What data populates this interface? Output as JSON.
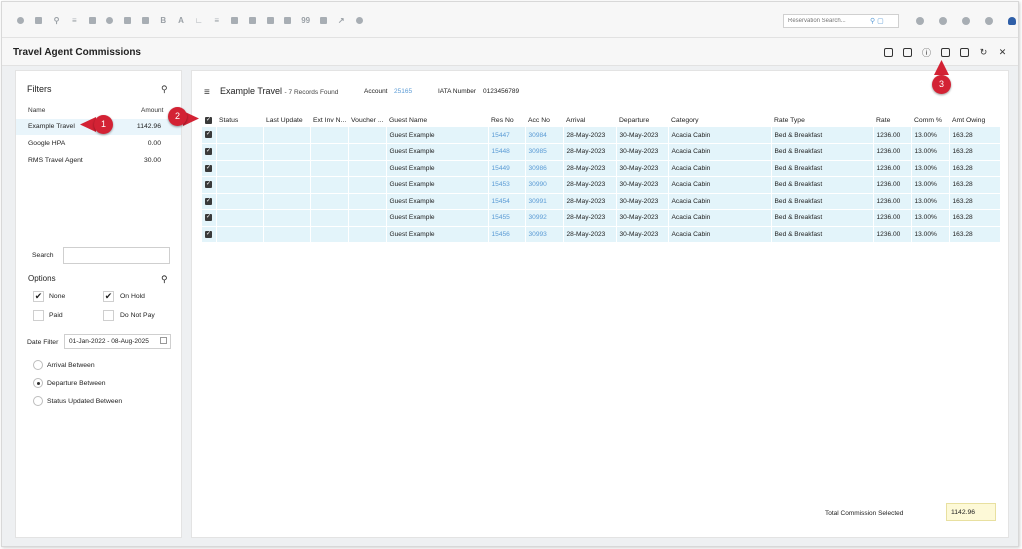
{
  "toolbar": {
    "icons": [
      "circle-icon",
      "calendar-icon",
      "search-icon",
      "sliders-icon",
      "grid-icon",
      "users-icon",
      "money-icon",
      "map-icon",
      "bold-icon",
      "font-icon",
      "chart-icon",
      "list-icon",
      "card-icon",
      "document-icon",
      "cart-icon",
      "ticket-icon",
      "quote-icon",
      "bed-icon",
      "tools-icon",
      "settings-icon"
    ],
    "letters": {
      "bold": "B",
      "font": "A",
      "quote": "99"
    },
    "search_placeholder": "Reservation Search..."
  },
  "page": {
    "title": "Travel Agent Commissions"
  },
  "filters": {
    "title": "Filters",
    "col_name": "Name",
    "col_amount": "Amount",
    "agents": [
      {
        "name": "Example Travel",
        "amount": "1142.96"
      },
      {
        "name": "Google HPA",
        "amount": "0.00"
      },
      {
        "name": "RMS Travel Agent",
        "amount": "30.00"
      }
    ],
    "search_label": "Search",
    "search_value": "",
    "options_title": "Options",
    "options": [
      {
        "label": "None",
        "checked": true
      },
      {
        "label": "On Hold",
        "checked": true
      },
      {
        "label": "Paid",
        "checked": false
      },
      {
        "label": "Do Not Pay",
        "checked": false
      }
    ],
    "date_filter_label": "Date Filter",
    "date_range": "01-Jan-2022   -   08-Aug-2025",
    "radios": [
      {
        "label": "Arrival Between",
        "selected": false
      },
      {
        "label": "Departure Between",
        "selected": true
      },
      {
        "label": "Status Updated Between",
        "selected": false
      }
    ]
  },
  "main": {
    "agent_name": "Example Travel",
    "records_found": " - 7 Records Found",
    "account_label": "Account",
    "account_value": "25165",
    "iata_label": "IATA Number",
    "iata_value": "0123456789",
    "columns": [
      "Status",
      "Last Update",
      "Ext Inv N...",
      "Voucher ...",
      "Guest Name",
      "Res No",
      "Acc No",
      "Arrival",
      "Departure",
      "Category",
      "Rate Type",
      "Rate",
      "Comm %",
      "Amt Owing"
    ],
    "rows": [
      {
        "status": "",
        "last_update": "",
        "ext_inv": "",
        "voucher": "",
        "guest": "Guest Example",
        "res_no": "15447",
        "acc_no": "30984",
        "arrival": "28-May-2023",
        "departure": "30-May-2023",
        "category": "Acacia Cabin",
        "rate_type": "Bed & Breakfast",
        "rate": "1236.00",
        "comm": "13.00%",
        "owing": "163.28"
      },
      {
        "status": "",
        "last_update": "",
        "ext_inv": "",
        "voucher": "",
        "guest": "Guest Example",
        "res_no": "15448",
        "acc_no": "30985",
        "arrival": "28-May-2023",
        "departure": "30-May-2023",
        "category": "Acacia Cabin",
        "rate_type": "Bed & Breakfast",
        "rate": "1236.00",
        "comm": "13.00%",
        "owing": "163.28"
      },
      {
        "status": "",
        "last_update": "",
        "ext_inv": "",
        "voucher": "",
        "guest": "Guest Example",
        "res_no": "15449",
        "acc_no": "30986",
        "arrival": "28-May-2023",
        "departure": "30-May-2023",
        "category": "Acacia Cabin",
        "rate_type": "Bed & Breakfast",
        "rate": "1236.00",
        "comm": "13.00%",
        "owing": "163.28"
      },
      {
        "status": "",
        "last_update": "",
        "ext_inv": "",
        "voucher": "",
        "guest": "Guest Example",
        "res_no": "15453",
        "acc_no": "30990",
        "arrival": "28-May-2023",
        "departure": "30-May-2023",
        "category": "Acacia Cabin",
        "rate_type": "Bed & Breakfast",
        "rate": "1236.00",
        "comm": "13.00%",
        "owing": "163.28"
      },
      {
        "status": "",
        "last_update": "",
        "ext_inv": "",
        "voucher": "",
        "guest": "Guest Example",
        "res_no": "15454",
        "acc_no": "30991",
        "arrival": "28-May-2023",
        "departure": "30-May-2023",
        "category": "Acacia Cabin",
        "rate_type": "Bed & Breakfast",
        "rate": "1236.00",
        "comm": "13.00%",
        "owing": "163.28"
      },
      {
        "status": "",
        "last_update": "",
        "ext_inv": "",
        "voucher": "",
        "guest": "Guest Example",
        "res_no": "15455",
        "acc_no": "30992",
        "arrival": "28-May-2023",
        "departure": "30-May-2023",
        "category": "Acacia Cabin",
        "rate_type": "Bed & Breakfast",
        "rate": "1236.00",
        "comm": "13.00%",
        "owing": "163.28"
      },
      {
        "status": "",
        "last_update": "",
        "ext_inv": "",
        "voucher": "",
        "guest": "Guest Example",
        "res_no": "15456",
        "acc_no": "30993",
        "arrival": "28-May-2023",
        "departure": "30-May-2023",
        "category": "Acacia Cabin",
        "rate_type": "Bed & Breakfast",
        "rate": "1236.00",
        "comm": "13.00%",
        "owing": "163.28"
      }
    ],
    "total_label": "Total Commission Selected",
    "total_value": "1142.96"
  },
  "badges": [
    "1",
    "2",
    "3"
  ],
  "colors": {
    "accent": "#5b9bd5",
    "badge": "#d32234",
    "row_bg": "#e3f4fa",
    "total_bg": "#fdf9d7"
  }
}
